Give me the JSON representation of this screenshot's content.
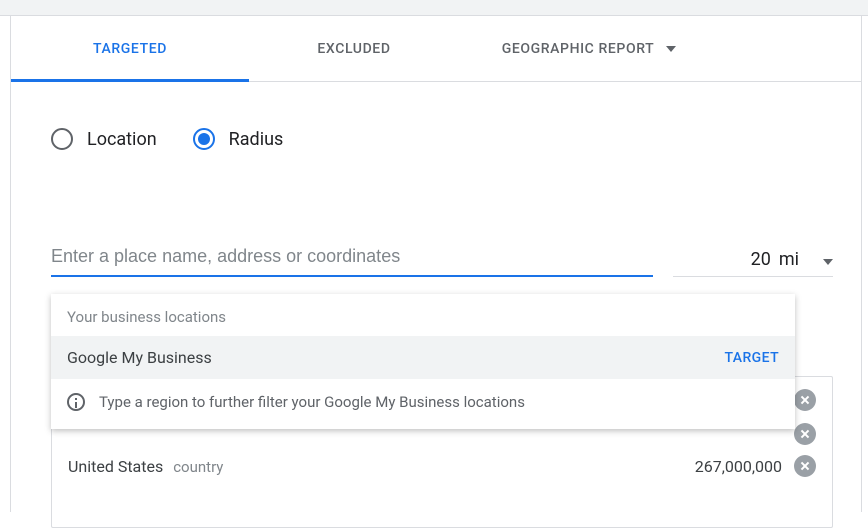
{
  "tabs": {
    "targeted": "TARGETED",
    "excluded": "EXCLUDED",
    "geo_report": "GEOGRAPHIC REPORT"
  },
  "radio": {
    "location": "Location",
    "radius": "Radius"
  },
  "search": {
    "placeholder": "Enter a place name, address or coordinates"
  },
  "distance": {
    "value": "20",
    "unit": "mi"
  },
  "dropdown": {
    "header": "Your business locations",
    "item_label": "Google My Business",
    "action": "TARGET",
    "hint": "Type a region to further filter your Google My Business locations"
  },
  "results": {
    "row3": {
      "name": "United States",
      "type": "country",
      "reach": "267,000,000"
    }
  }
}
